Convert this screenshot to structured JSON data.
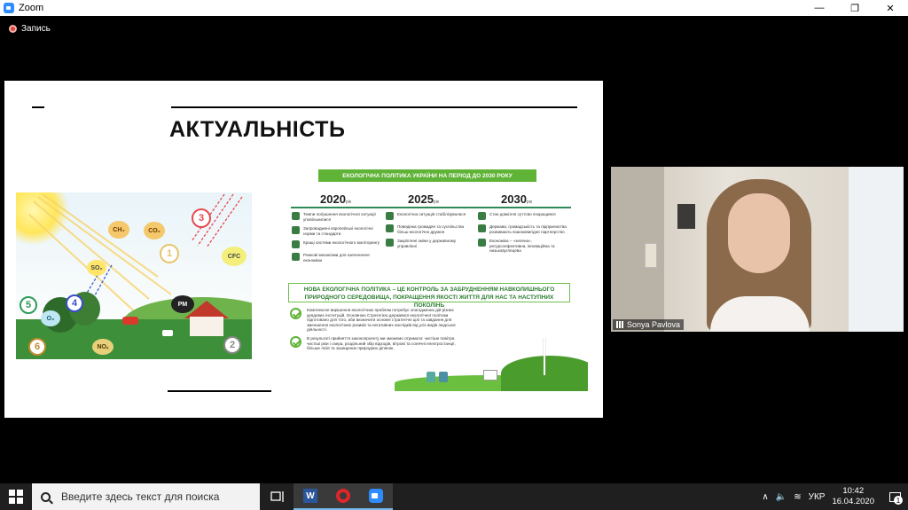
{
  "window": {
    "title": "Zoom",
    "minimize": "—",
    "maximize": "❐",
    "close": "✕"
  },
  "recording": {
    "label": "Запись"
  },
  "slide": {
    "heading": "АКТУАЛЬНІСТЬ",
    "pollution": {
      "gases": [
        "CH₄",
        "CO₂",
        "SO₂",
        "CFC",
        "PM",
        "O₃",
        "NOₓ"
      ],
      "numbers": [
        "1",
        "2",
        "3",
        "4",
        "5",
        "6"
      ]
    },
    "policy": {
      "banner": "ЕКОЛОГІЧНА ПОЛІТИКА УКРАЇНИ НА ПЕРІОД ДО 2030 РОКУ",
      "years": [
        {
          "year": "2020",
          "suffix": "рік"
        },
        {
          "year": "2025",
          "suffix": "рік"
        },
        {
          "year": "2030",
          "suffix": "рік"
        }
      ],
      "columns": [
        [
          "Темпи погіршення екологічної ситуації уповільнилися",
          "Запроваджені європейські екологічні норми та стандарти",
          "Кращі системи екологічного моніторингу",
          "Ринкові механізми для озеленення економіки"
        ],
        [
          "Екологічна ситуація стабілізувалася",
          "Поведінка громадян та суспільства більш екологічно дружня",
          "Закріплені зміни у державному управлінні"
        ],
        [
          "Стан довкілля суттєво покращився",
          "Держава, громадськість та підприємства розвивають взаємовигідне партнерство",
          "Економіка – «зелена», ресурсоефективна, інноваційна та низьковуглецева"
        ]
      ],
      "mid_banner": "НОВА ЕКОЛОГІЧНА ПОЛІТИКА – ЦЕ КОНТРОЛЬ ЗА ЗАБРУДНЕННЯМ НАВКОЛИШНЬОГО ПРИРОДНОГО СЕРЕДОВИЩА, ПОКРАЩЕННЯ ЯКОСТІ ЖИТТЯ ДЛЯ НАС ТА НАСТУПНИХ ПОКОЛІНЬ",
      "points": [
        "Комплексне вирішення екологічних проблем потребує злагоджених дій різних урядових інституцій. Основною Стратегією державної екологічної політики підготовано для того, аби визначити основні стратегічні цілі та завдання для зменшення екологічних ризиків та негативних наслідків від усіх видів людської діяльності.",
        "В результаті прийняття законопроекту ми зможемо отримати: чистіше повітря, чистіші ріки і озера, роздільний збір відходів, вітрові та сонячні електростанції, більше лісів та захищених природних ділянок."
      ]
    }
  },
  "participant": {
    "name": "Sonya Pavlova"
  },
  "taskbar": {
    "search_placeholder": "Введите здесь текст для поиска",
    "apps": [
      "task-view",
      "word",
      "opera",
      "zoom"
    ],
    "tray": {
      "lang": "УКР",
      "time": "10:42",
      "date": "16.04.2020",
      "notifications": "1"
    }
  },
  "colors": {
    "accent_green": "#5fb336",
    "zoom_blue": "#2d8cff"
  }
}
